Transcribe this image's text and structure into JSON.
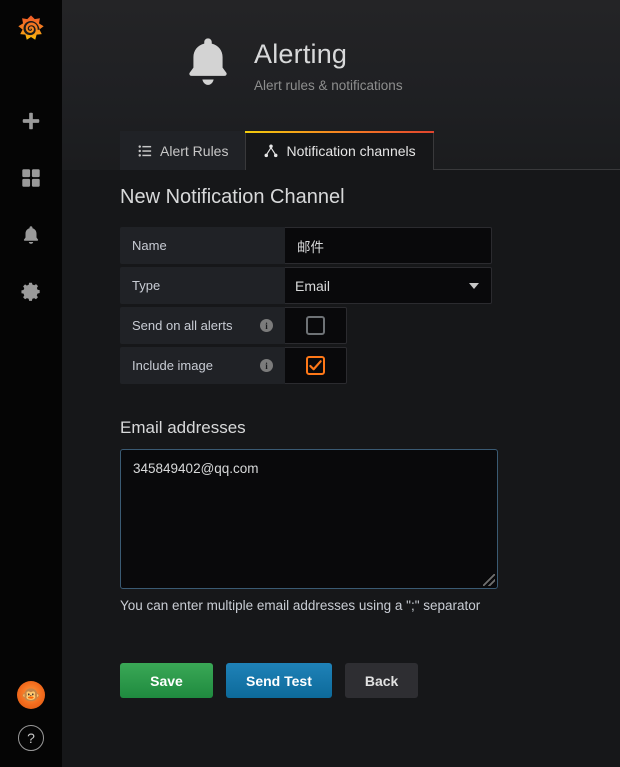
{
  "sidebar": {
    "brand_icon": "grafana-logo-icon",
    "items": [
      {
        "icon": "plus-icon",
        "name": "create"
      },
      {
        "icon": "dashboards-grid-icon",
        "name": "dashboards"
      },
      {
        "icon": "bell-icon",
        "name": "alerting"
      },
      {
        "icon": "gear-icon",
        "name": "configuration"
      }
    ],
    "bottom": {
      "avatar_icon": "user-avatar",
      "help_label": "?"
    }
  },
  "header": {
    "icon": "bell-icon",
    "title": "Alerting",
    "subtitle": "Alert rules & notifications"
  },
  "tabs": [
    {
      "label": "Alert Rules",
      "icon": "list-icon",
      "active": false
    },
    {
      "label": "Notification channels",
      "icon": "sitemap-icon",
      "active": true
    }
  ],
  "main": {
    "section_title": "New Notification Channel",
    "fields": {
      "name": {
        "label": "Name",
        "value": "邮件",
        "placeholder": ""
      },
      "type": {
        "label": "Type",
        "value": "Email",
        "options": [
          "Email"
        ]
      },
      "send_on_all_alerts": {
        "label": "Send on all alerts",
        "checked": false,
        "info_icon": "info-icon"
      },
      "include_image": {
        "label": "Include image",
        "checked": true,
        "info_icon": "info-icon"
      }
    },
    "email_addresses": {
      "label": "Email addresses",
      "value": "345849402@qq.com",
      "placeholder": "",
      "helper": "You can enter multiple email addresses using a \";\" separator"
    },
    "buttons": {
      "save": "Save",
      "send_test": "Send Test",
      "back": "Back"
    }
  },
  "colors": {
    "accent_orange": "#ff7818",
    "save_green": "#1f8a3f",
    "test_blue": "#0d6a9a",
    "page_bg": "#161719",
    "panel_bg": "#202226"
  }
}
